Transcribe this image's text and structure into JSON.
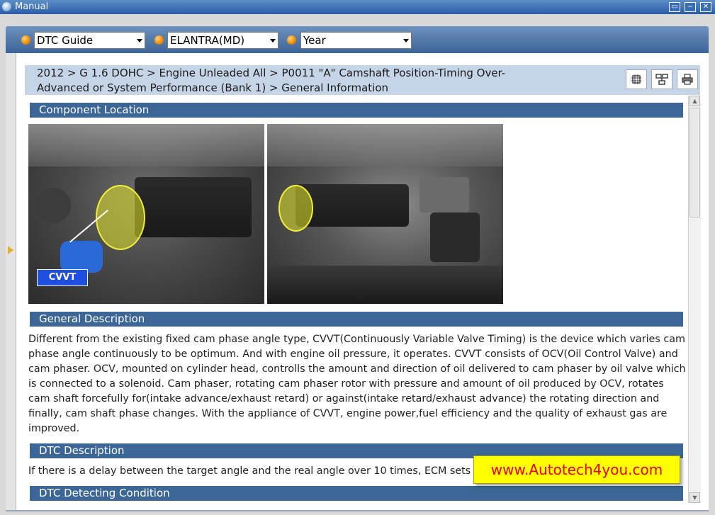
{
  "window": {
    "title": "Manual",
    "buttons": {
      "maximize": "▭",
      "minimize": "−",
      "close": "✕"
    }
  },
  "toolbar": {
    "selects": [
      {
        "value": "DTC Guide"
      },
      {
        "value": "ELANTRA(MD)"
      },
      {
        "value": "Year"
      }
    ]
  },
  "breadcrumb": {
    "line1": "2012 > G 1.6 DOHC > Engine Unleaded All > P0011 \"A\" Camshaft Position-Timing Over-",
    "line2": "Advanced or System Performance (Bank 1) > General Information"
  },
  "tool_icons": [
    "settings-icon",
    "network-icon",
    "print-icon"
  ],
  "sections": {
    "component_location": "Component Location",
    "general_description": "General Description",
    "dtc_description": "DTC Description",
    "dtc_detecting_condition": "DTC Detecting Condition"
  },
  "photo_label": "CVVT",
  "general_description_text": "Different from the existing fixed cam phase angle type, CVVT(Continuously Variable Valve Timing) is the device which varies cam phase angle continuously to be optimum. And with engine oil pressure, it operates. CVVT consists of OCV(Oil Control Valve) and cam phaser. OCV, mounted on cylinder head, controlls the amount and direction of oil delivered to cam phaser by oil valve which is connected to a solenoid. Cam phaser, rotating cam phaser rotor with pressure and amount of oil produced by OCV, rotates cam shaft forcefully for(intake advance/exhaust retard) or against(intake retard/exhaust advance) the rotating direction and finally, cam shaft phase changes. With the appliance of CVVT, engine power,fuel efficiency and the quality of exhaust gas are improved.",
  "dtc_description_text": "If there is a delay between the target angle and the real angle over 10 times, ECM sets",
  "watermark": "www.Autotech4you.com",
  "colors": {
    "section_header": "#3b6695",
    "breadcrumb_bg": "#c5d4e6",
    "watermark_bg": "#ffff00",
    "watermark_text": "#e00000"
  }
}
